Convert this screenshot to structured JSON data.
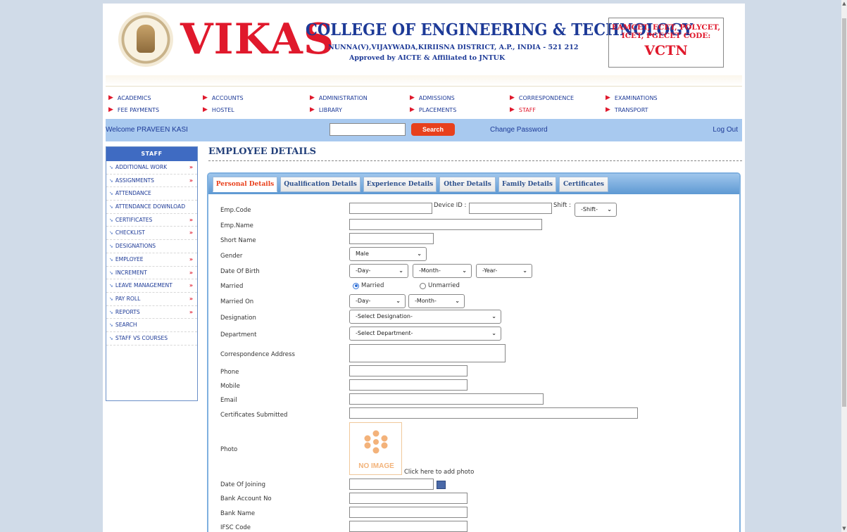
{
  "header": {
    "brand": "VIKAS",
    "college": "COLLEGE OF ENGINEERING & TECHNOLOGY",
    "address": "NUNNA(V),VIJAYWADA,KIRIISNA DISTRICT, A.P., INDIA - 521 212",
    "approved": "Approved by AICTE & Affiliated to JNTUK",
    "codes_label": "EAMCET, ECET, POLYCET, ICET, PGECET CODE:",
    "code": "VCTN"
  },
  "topnav": {
    "items": [
      "ACADEMICS",
      "ACCOUNTS",
      "ADMINISTRATION",
      "ADMISSIONS",
      "CORRESPONDENCE",
      "EXAMINATIONS",
      "FEE PAYMENTS",
      "HOSTEL",
      "LIBRARY",
      "PLACEMENTS",
      "STAFF",
      "TRANSPORT"
    ]
  },
  "welcome": {
    "text": "Welcome PRAVEEN KASI",
    "search_label": "Search",
    "change_password": "Change Password",
    "logout": "Log Out"
  },
  "sidebar": {
    "title": "STAFF",
    "items": [
      "ADDITIONAL WORK",
      "ASSIGNMENTS",
      "ATTENDANCE",
      "ATTENDANCE DOWNLOAD",
      "CERTIFICATES",
      "CHECKLIST",
      "DESIGNATIONS",
      "EMPLOYEE",
      "INCREMENT",
      "LEAVE MANAGEMENT",
      "PAY ROLL",
      "REPORTS",
      "SEARCH",
      "STAFF VS COURSES"
    ],
    "chevron": "»"
  },
  "main": {
    "title": "EMPLOYEE DETAILS",
    "tabs": [
      "Personal Details",
      "Qualification Details",
      "Experience Details",
      "Other Details",
      "Family Details",
      "Certificates"
    ]
  },
  "form": {
    "emp_code": "Emp.Code",
    "device_id": "Device ID :",
    "shift": "Shift :",
    "shift_value": "-Shift-",
    "emp_name": "Emp.Name",
    "short_name": "Short Name",
    "gender": "Gender",
    "gender_value": "Male",
    "dob": "Date Of Birth",
    "day": "-Day-",
    "month": "-Month-",
    "year": "-Year-",
    "married": "Married",
    "married_opt": "Married",
    "unmarried_opt": "Unmarried",
    "married_on": "Married On",
    "designation": "Designation",
    "designation_value": "-Select Designation-",
    "department": "Department",
    "department_value": "-Select Department-",
    "address": "Correspondence Address",
    "phone": "Phone",
    "mobile": "Mobile",
    "email": "Email",
    "certificates": "Certificates Submitted",
    "photo": "Photo",
    "no_image": "NO IMAGE",
    "add_photo": "Click here to add photo",
    "joining": "Date Of Joining",
    "bank_account": "Bank Account No",
    "bank_name": "Bank Name",
    "ifsc": "IFSC Code"
  },
  "colors": {
    "accent_red": "#e0192c",
    "brand_blue": "#1d3a97",
    "bar_blue": "#a8c9ef"
  }
}
